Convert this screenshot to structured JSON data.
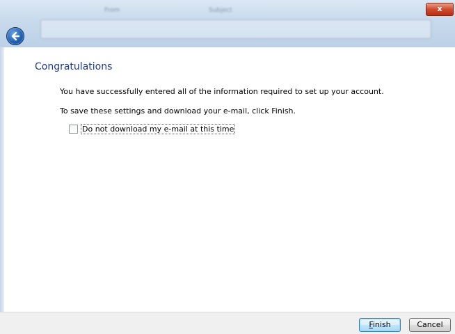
{
  "window": {
    "close_label": "x",
    "ghost_tabs": [
      "Subject",
      "From"
    ]
  },
  "page": {
    "heading": "Congratulations",
    "line1": "You have successfully entered all of the information required to set up your account.",
    "line2": "To save these settings and download your e-mail, click Finish."
  },
  "option": {
    "checked": false,
    "label": "Do not download my e-mail at this time"
  },
  "buttons": {
    "finish_accesskey": "F",
    "finish_rest": "inish",
    "cancel": "Cancel"
  }
}
